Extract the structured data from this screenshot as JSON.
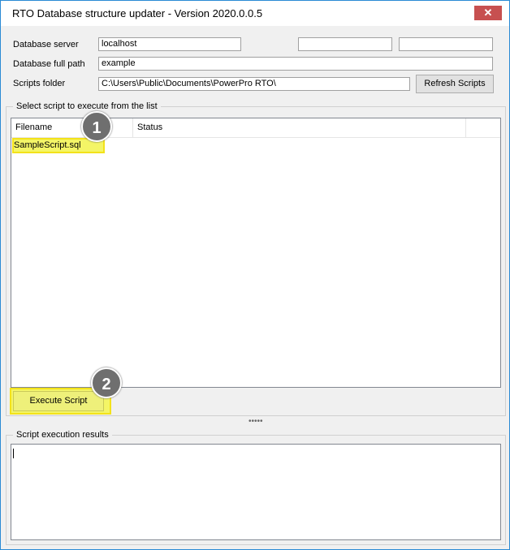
{
  "window": {
    "title": "RTO Database structure updater - Version 2020.0.0.5",
    "close_glyph": "✕"
  },
  "form": {
    "server_label": "Database server",
    "server_value": "localhost",
    "path_label": "Database full path",
    "path_value": "example",
    "scripts_label": "Scripts folder",
    "scripts_value": "C:\\Users\\Public\\Documents\\PowerPro RTO\\",
    "refresh_button": "Refresh Scripts"
  },
  "scripts_group": {
    "legend": "Select script to execute from the list",
    "columns": [
      "Filename",
      "Status"
    ],
    "rows": [
      {
        "filename": "SampleScript.sql",
        "status": ""
      }
    ],
    "execute_button": "Execute Script"
  },
  "results_group": {
    "legend": "Script execution results",
    "value": ""
  },
  "annotations": {
    "badge_1": "1",
    "badge_2": "2",
    "highlight_color": "#f4f566",
    "badge_color": "#6f6f6f"
  },
  "splitter_glyph": "•••••"
}
